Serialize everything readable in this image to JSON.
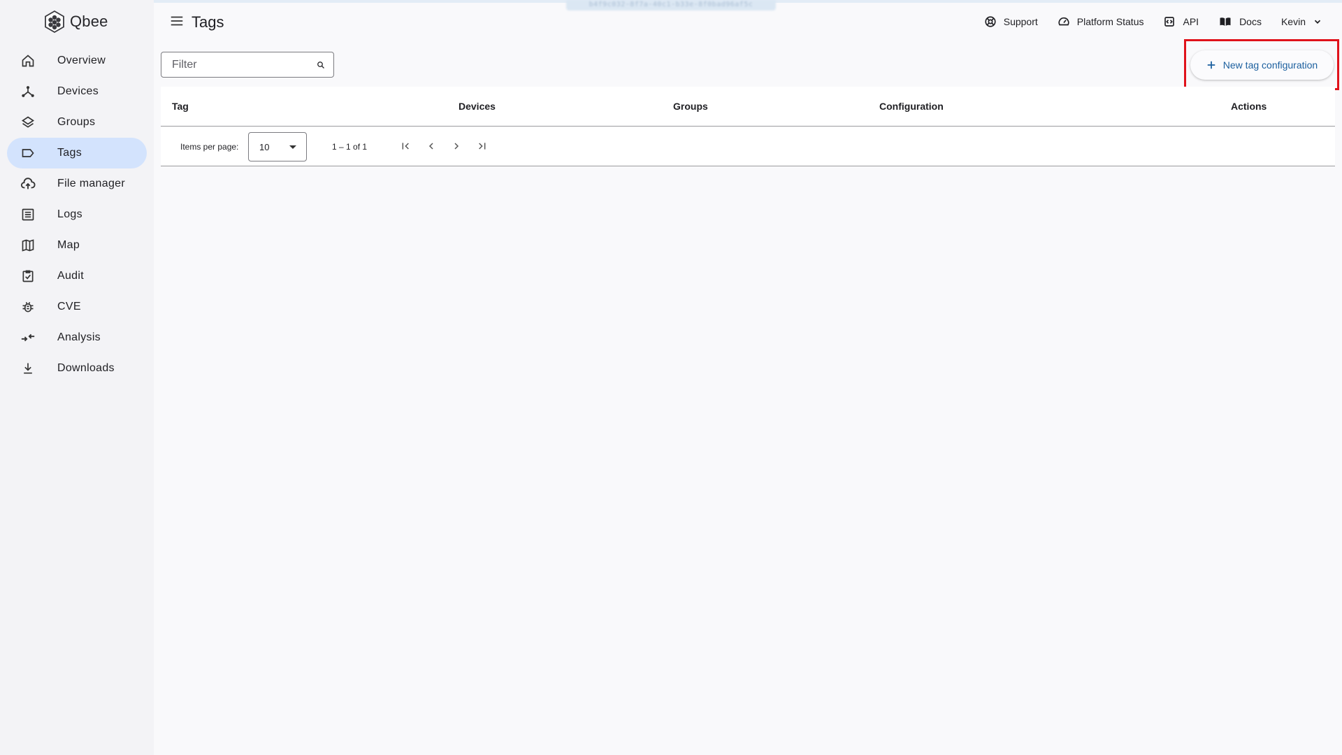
{
  "app": {
    "name": "Qbee",
    "env_banner": "b4f9c032-8f7a-40c1-b33e-8f0bad96af5c"
  },
  "sidebar": {
    "items": [
      {
        "label": "Overview",
        "icon": "home-icon"
      },
      {
        "label": "Devices",
        "icon": "devices-tree-icon"
      },
      {
        "label": "Groups",
        "icon": "layers-icon"
      },
      {
        "label": "Tags",
        "icon": "tag-icon",
        "active": true
      },
      {
        "label": "File manager",
        "icon": "cloud-upload-icon"
      },
      {
        "label": "Logs",
        "icon": "list-icon"
      },
      {
        "label": "Map",
        "icon": "map-icon"
      },
      {
        "label": "Audit",
        "icon": "clipboard-check-icon"
      },
      {
        "label": "CVE",
        "icon": "bug-icon"
      },
      {
        "label": "Analysis",
        "icon": "compare-arrows-icon"
      },
      {
        "label": "Downloads",
        "icon": "download-icon"
      }
    ]
  },
  "header": {
    "title": "Tags",
    "links": {
      "support": "Support",
      "platform_status": "Platform Status",
      "api": "API",
      "docs": "Docs",
      "user": "Kevin"
    }
  },
  "filter": {
    "placeholder": "Filter",
    "value": ""
  },
  "actions": {
    "new_tag": "New tag configuration"
  },
  "table": {
    "columns": [
      "Tag",
      "Devices",
      "Groups",
      "Configuration",
      "Actions"
    ],
    "rows": []
  },
  "paginator": {
    "items_per_page_label": "Items per page:",
    "items_per_page": "10",
    "range": "1 – 1 of 1"
  },
  "colors": {
    "accent": "#1b5f9e",
    "active_nav": "#d3e3fd",
    "highlight": "#e0121b"
  }
}
